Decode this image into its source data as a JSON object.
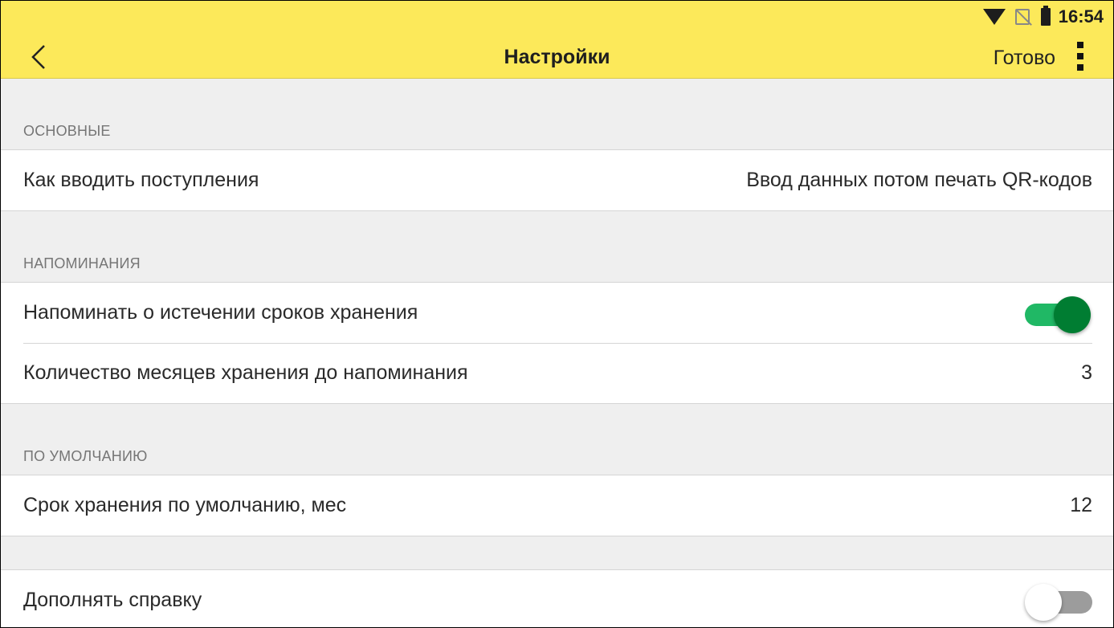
{
  "status_bar": {
    "time": "16:54",
    "icons": [
      "wifi-icon",
      "no-sim-icon",
      "battery-icon"
    ]
  },
  "app_bar": {
    "title": "Настройки",
    "done_label": "Готово",
    "back_icon": "chevron-left-icon",
    "menu_icon": "more-vertical-icon"
  },
  "colors": {
    "app_bar": "#fce95a",
    "toggle_on_track": "#20b865",
    "toggle_on_thumb": "#007d32",
    "toggle_off_track": "#9c9c9c"
  },
  "sections": {
    "main": {
      "title": "Основные",
      "items": [
        {
          "label": "Как вводить поступления",
          "value": "Ввод данных потом печать QR-кодов"
        }
      ]
    },
    "reminders": {
      "title": "Напоминания",
      "items": [
        {
          "label": "Напоминать о истечении сроков хранения",
          "toggle": true
        },
        {
          "label": "Количество месяцев хранения до напоминания",
          "value": "3"
        }
      ]
    },
    "defaults": {
      "title": "По умолчанию",
      "items": [
        {
          "label": "Срок хранения по умолчанию, мес",
          "value": "12"
        }
      ]
    },
    "extra": {
      "items": [
        {
          "label": "Дополнять справку",
          "toggle": false
        }
      ]
    }
  }
}
